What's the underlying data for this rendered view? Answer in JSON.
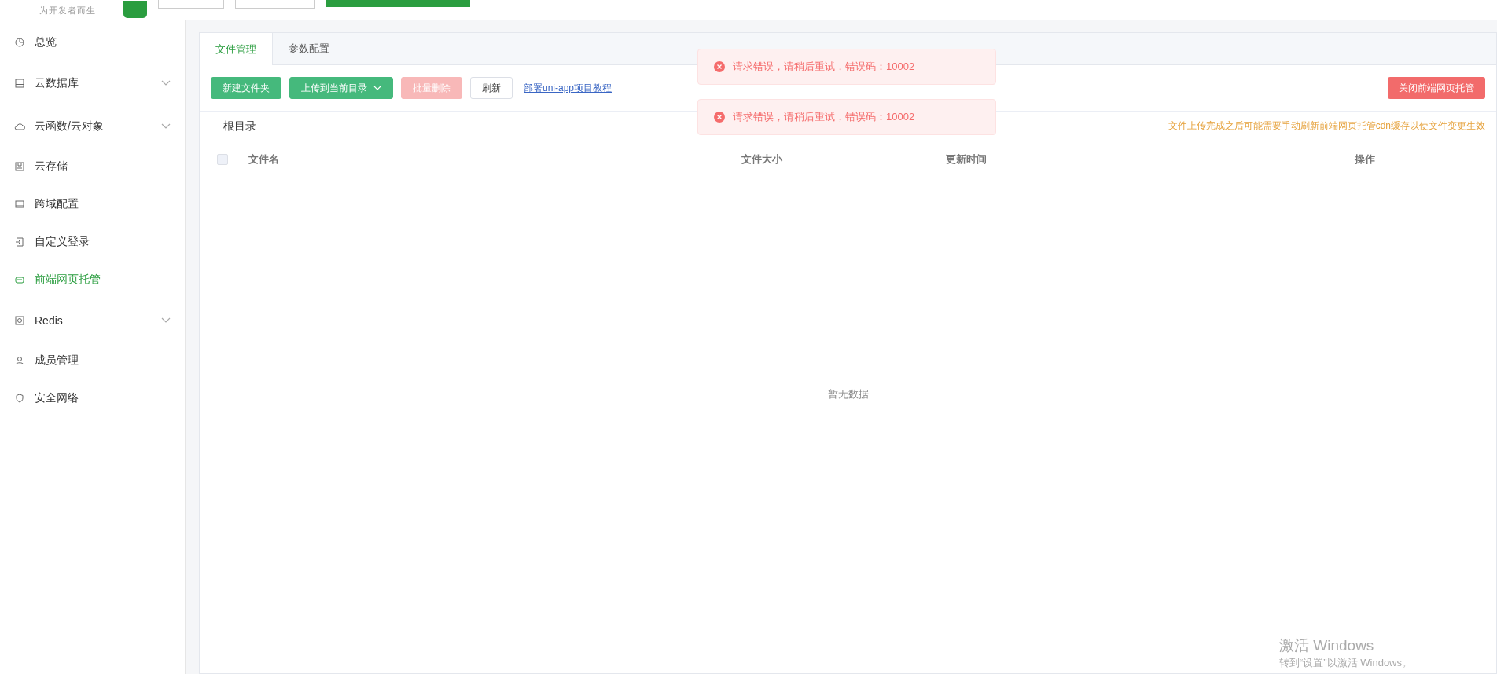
{
  "header": {
    "tagline": "为开发者而生"
  },
  "sidebar": {
    "items": [
      {
        "label": "总览",
        "expandable": false,
        "selected": false
      },
      {
        "label": "云数据库",
        "expandable": true,
        "selected": false
      },
      {
        "label": "云函数/云对象",
        "expandable": true,
        "selected": false
      },
      {
        "label": "云存储",
        "expandable": false,
        "selected": false
      },
      {
        "label": "跨域配置",
        "expandable": false,
        "selected": false
      },
      {
        "label": "自定义登录",
        "expandable": false,
        "selected": false
      },
      {
        "label": "前端网页托管",
        "expandable": false,
        "selected": true
      },
      {
        "label": "Redis",
        "expandable": true,
        "selected": false
      },
      {
        "label": "成员管理",
        "expandable": false,
        "selected": false
      },
      {
        "label": "安全网络",
        "expandable": false,
        "selected": false
      }
    ]
  },
  "tabs": [
    {
      "label": "文件管理",
      "selected": true
    },
    {
      "label": "参数配置",
      "selected": false
    }
  ],
  "toolbar": {
    "buttons": [
      {
        "label": "新建文件夹",
        "kind": "primary",
        "disabled": false,
        "dropdown": false
      },
      {
        "label": "上传到当前目录",
        "kind": "primary",
        "disabled": false,
        "dropdown": true
      },
      {
        "label": "批量删除",
        "kind": "danger",
        "disabled": true,
        "dropdown": false
      },
      {
        "label": "刷新",
        "kind": "plain",
        "disabled": false,
        "dropdown": false
      }
    ],
    "link": "部署uni-app项目教程",
    "close_button": "关闭前端网页托管"
  },
  "breadcrumb": "根目录",
  "notice": "文件上传完成之后可能需要手动刷新前端网页托管cdn缓存以使文件变更生效",
  "table": {
    "select_all": {
      "checked": false
    },
    "columns": [
      "文件名",
      "文件大小",
      "更新时间",
      "操作"
    ],
    "empty_text": "暂无数据"
  },
  "toasts": [
    {
      "message": "请求错误，请稍后重试，错误码：10002"
    },
    {
      "message": "请求错误，请稍后重试，错误码：10002"
    }
  ],
  "os_overlay": {
    "title": "激活 Windows",
    "subtitle": "转到“设置”以激活 Windows。"
  }
}
